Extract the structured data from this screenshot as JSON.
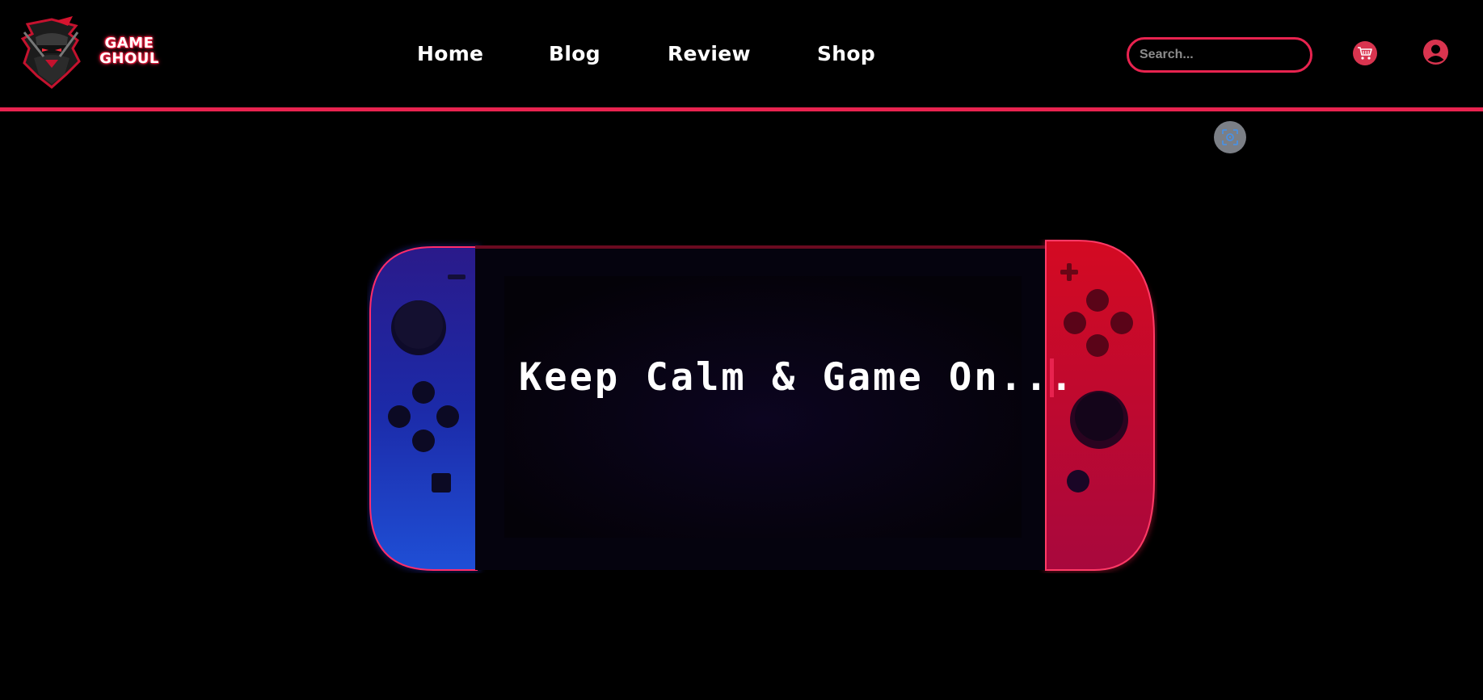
{
  "brand": {
    "line1": "GAME",
    "line2": "GHOUL",
    "accent": "#e8234f"
  },
  "nav": {
    "home": "Home",
    "blog": "Blog",
    "review": "Review",
    "shop": "Shop"
  },
  "search": {
    "placeholder": "Search..."
  },
  "icons": {
    "cart": "cart-icon",
    "user": "user-icon",
    "lens": "image-search-icon",
    "logo": "ninja-mascot-icon"
  },
  "hero": {
    "headline": "Keep Calm & Game On..."
  }
}
